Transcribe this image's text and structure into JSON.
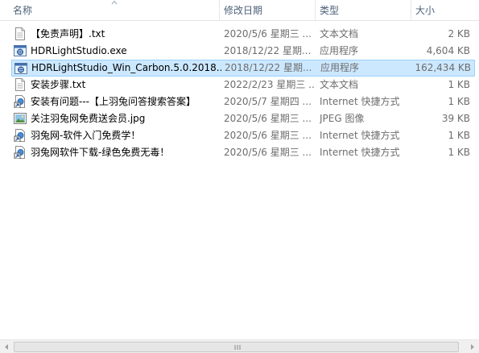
{
  "columns": {
    "name": "名称",
    "date": "修改日期",
    "type": "类型",
    "size": "大小"
  },
  "files": [
    {
      "name": "【免责声明】.txt",
      "date": "2020/5/6 星期三 ...",
      "type": "文本文档",
      "size": "2 KB",
      "icon": "text-file-icon",
      "selected": false
    },
    {
      "name": "HDRLightStudio.exe",
      "date": "2018/12/22 星期...",
      "type": "应用程序",
      "size": "4,604 KB",
      "icon": "app-exe-icon",
      "selected": false
    },
    {
      "name": "HDRLightStudio_Win_Carbon.5.0.2018...",
      "date": "2018/12/22 星期...",
      "type": "应用程序",
      "size": "162,434 KB",
      "icon": "app-exe-icon",
      "selected": true
    },
    {
      "name": "安装步骤.txt",
      "date": "2022/2/23 星期三 ...",
      "type": "文本文档",
      "size": "1 KB",
      "icon": "text-file-icon",
      "selected": false
    },
    {
      "name": "安装有问题---【上羽兔问答搜索答案】",
      "date": "2020/5/7 星期四 ...",
      "type": "Internet 快捷方式",
      "size": "1 KB",
      "icon": "internet-shortcut-icon",
      "selected": false
    },
    {
      "name": "关注羽兔网免费送会员.jpg",
      "date": "2020/5/6 星期三 ...",
      "type": "JPEG 图像",
      "size": "39 KB",
      "icon": "image-file-icon",
      "selected": false
    },
    {
      "name": "羽兔网-软件入门免费学！",
      "date": "2020/5/6 星期三 ...",
      "type": "Internet 快捷方式",
      "size": "1 KB",
      "icon": "internet-shortcut-icon",
      "selected": false
    },
    {
      "name": "羽兔网软件下载-绿色免费无毒！",
      "date": "2020/5/6 星期三 ...",
      "type": "Internet 快捷方式",
      "size": "1 KB",
      "icon": "internet-shortcut-icon",
      "selected": false
    }
  ],
  "colors": {
    "header_text": "#4c607a",
    "selection_bg": "#cce8ff",
    "selection_border": "#99d1ff",
    "meta_text": "#6d6d6d"
  }
}
